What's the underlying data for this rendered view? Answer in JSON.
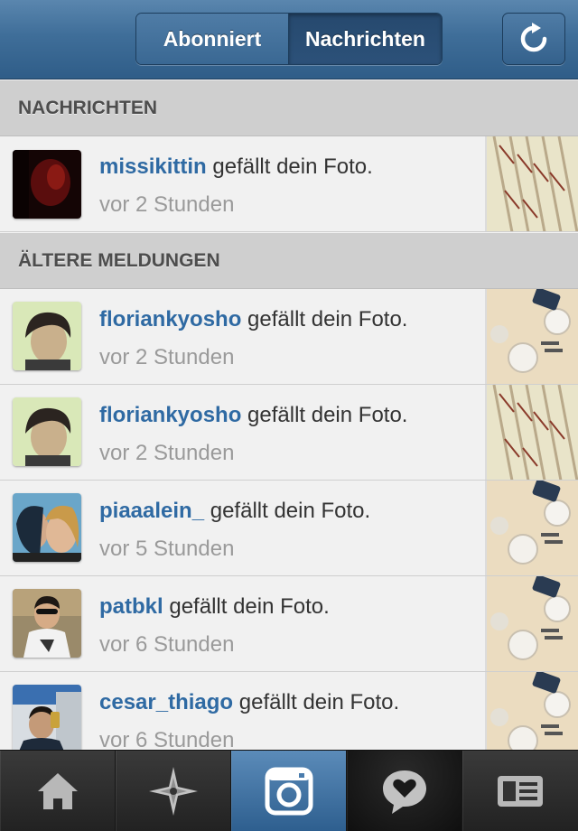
{
  "header": {
    "tabs": [
      {
        "label": "Abonniert",
        "active": false
      },
      {
        "label": "Nachrichten",
        "active": true
      }
    ],
    "refresh_icon": "refresh-icon"
  },
  "sections": {
    "recent": "NACHRICHTEN",
    "older": "ÄLTERE MELDUNGEN"
  },
  "items": [
    {
      "username": "missikittin",
      "action": " gefällt dein Foto.",
      "time": "vor 2 Stunden"
    },
    {
      "username": "floriankyosho",
      "action": " gefällt dein Foto.",
      "time": "vor 2 Stunden"
    },
    {
      "username": "floriankyosho",
      "action": " gefällt dein Foto.",
      "time": "vor 2 Stunden"
    },
    {
      "username": "piaaalein_",
      "action": " gefällt dein Foto.",
      "time": "vor 5 Stunden"
    },
    {
      "username": "patbkl",
      "action": " gefällt dein Foto.",
      "time": "vor 6 Stunden"
    },
    {
      "username": "cesar_thiago",
      "action": " gefällt dein Foto.",
      "time": "vor 6 Stunden"
    }
  ],
  "tabbar": {
    "items": [
      "home-icon",
      "explore-icon",
      "camera-icon",
      "news-icon",
      "profile-icon"
    ],
    "active": "news-icon"
  },
  "colors": {
    "username": "#2f6aa3",
    "header": "#3f6e99",
    "camera_tab": "#4a7cad"
  }
}
